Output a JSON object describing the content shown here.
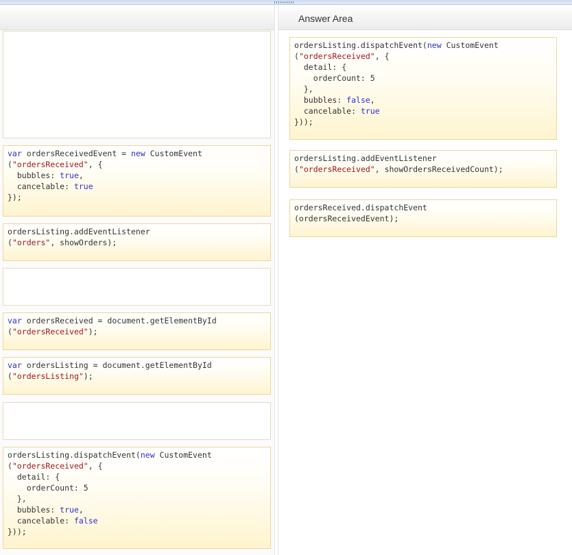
{
  "answer_area": {
    "title": "Answer Area"
  },
  "left_boxes": [
    {
      "id": "empty-1",
      "lines": []
    },
    {
      "id": "create-event",
      "lines": [
        [
          {
            "t": "var",
            "c": "kw"
          },
          {
            "t": " ordersReceivedEvent = ",
            "c": "txt"
          },
          {
            "t": "new",
            "c": "kw"
          },
          {
            "t": " CustomEvent",
            "c": "txt"
          }
        ],
        [
          {
            "t": "(",
            "c": "txt"
          },
          {
            "t": "\"ordersReceived\"",
            "c": "str"
          },
          {
            "t": ", {",
            "c": "txt"
          }
        ],
        [
          {
            "t": "  bubbles: ",
            "c": "txt"
          },
          {
            "t": "true",
            "c": "kw"
          },
          {
            "t": ",",
            "c": "txt"
          }
        ],
        [
          {
            "t": "  cancelable: ",
            "c": "txt"
          },
          {
            "t": "true",
            "c": "kw"
          }
        ],
        [
          {
            "t": "});",
            "c": "txt"
          }
        ]
      ]
    },
    {
      "id": "add-listener-orders",
      "lines": [
        [
          {
            "t": "ordersListing.addEventListener",
            "c": "txt"
          }
        ],
        [
          {
            "t": "(",
            "c": "txt"
          },
          {
            "t": "\"orders\"",
            "c": "str"
          },
          {
            "t": ", showOrders);",
            "c": "txt"
          }
        ]
      ]
    },
    {
      "id": "empty-2",
      "lines": []
    },
    {
      "id": "get-orders-received",
      "lines": [
        [
          {
            "t": "var",
            "c": "kw"
          },
          {
            "t": " ordersReceived = document.getElementById",
            "c": "txt"
          }
        ],
        [
          {
            "t": "(",
            "c": "txt"
          },
          {
            "t": "\"ordersReceived\"",
            "c": "str"
          },
          {
            "t": ");",
            "c": "txt"
          }
        ]
      ]
    },
    {
      "id": "get-orders-listing",
      "lines": [
        [
          {
            "t": "var",
            "c": "kw"
          },
          {
            "t": " ordersListing = document.getElementById",
            "c": "txt"
          }
        ],
        [
          {
            "t": "(",
            "c": "txt"
          },
          {
            "t": "\"ordersListing\"",
            "c": "str"
          },
          {
            "t": ");",
            "c": "txt"
          }
        ]
      ]
    },
    {
      "id": "empty-3",
      "lines": []
    },
    {
      "id": "dispatch-bubbles-true",
      "lines": [
        [
          {
            "t": "ordersListing.dispatchEvent(",
            "c": "txt"
          },
          {
            "t": "new",
            "c": "kw"
          },
          {
            "t": " CustomEvent",
            "c": "txt"
          }
        ],
        [
          {
            "t": "(",
            "c": "txt"
          },
          {
            "t": "\"ordersReceived\"",
            "c": "str"
          },
          {
            "t": ", {",
            "c": "txt"
          }
        ],
        [
          {
            "t": "  detail: {",
            "c": "txt"
          }
        ],
        [
          {
            "t": "    orderCount: 5",
            "c": "txt"
          }
        ],
        [
          {
            "t": "  },",
            "c": "txt"
          }
        ],
        [
          {
            "t": "  bubbles: ",
            "c": "txt"
          },
          {
            "t": "true",
            "c": "kw"
          },
          {
            "t": ",",
            "c": "txt"
          }
        ],
        [
          {
            "t": "  cancelable: ",
            "c": "txt"
          },
          {
            "t": "false",
            "c": "kw"
          }
        ],
        [
          {
            "t": "}));",
            "c": "txt"
          }
        ]
      ]
    }
  ],
  "right_boxes": [
    {
      "id": "dispatch-bubbles-false",
      "lines": [
        [
          {
            "t": "ordersListing.dispatchEvent(",
            "c": "txt"
          },
          {
            "t": "new",
            "c": "kw"
          },
          {
            "t": " CustomEvent",
            "c": "txt"
          }
        ],
        [
          {
            "t": "(",
            "c": "txt"
          },
          {
            "t": "\"ordersReceived\"",
            "c": "str"
          },
          {
            "t": ", {",
            "c": "txt"
          }
        ],
        [
          {
            "t": "  detail: {",
            "c": "txt"
          }
        ],
        [
          {
            "t": "    orderCount: 5",
            "c": "txt"
          }
        ],
        [
          {
            "t": "  },",
            "c": "txt"
          }
        ],
        [
          {
            "t": "  bubbles: ",
            "c": "txt"
          },
          {
            "t": "false",
            "c": "kw"
          },
          {
            "t": ",",
            "c": "txt"
          }
        ],
        [
          {
            "t": "  cancelable: ",
            "c": "txt"
          },
          {
            "t": "true",
            "c": "kw"
          }
        ],
        [
          {
            "t": "}));",
            "c": "txt"
          }
        ]
      ]
    },
    {
      "id": "add-listener-orders-received",
      "lines": [
        [
          {
            "t": "ordersListing.addEventListener",
            "c": "txt"
          }
        ],
        [
          {
            "t": "(",
            "c": "txt"
          },
          {
            "t": "\"ordersReceived\"",
            "c": "str"
          },
          {
            "t": ", showOrdersReceivedCount);",
            "c": "txt"
          }
        ]
      ]
    },
    {
      "id": "dispatch-orders-received-event",
      "lines": [
        [
          {
            "t": "ordersReceived.dispatchEvent",
            "c": "txt"
          }
        ],
        [
          {
            "t": "(ordersReceivedEvent);",
            "c": "txt"
          }
        ]
      ]
    }
  ],
  "colors": {
    "keyword": "#2f2fd0",
    "string": "#a31515",
    "text": "#333333",
    "box_border": "#e8d79f",
    "box_fill": "#fff4cf"
  }
}
